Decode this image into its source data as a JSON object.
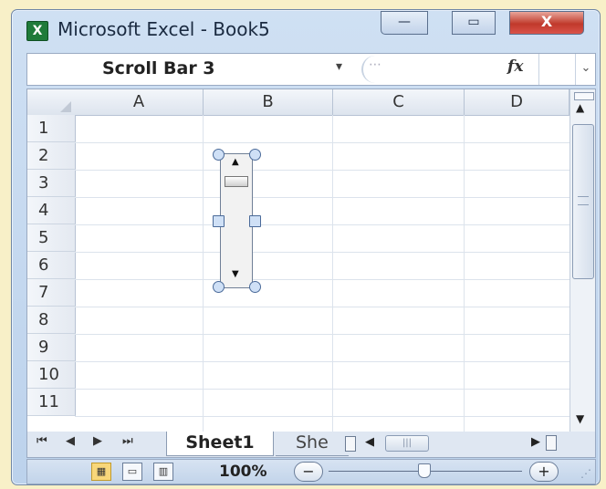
{
  "window": {
    "title": "Microsoft Excel - Book5",
    "app_icon_letter": "X",
    "minimize_glyph": "—",
    "maximize_glyph": "▭",
    "close_glyph": "X"
  },
  "formula_bar": {
    "name_box_value": "Scroll Bar 3",
    "name_box_dropdown": "▾",
    "fx_label": "fx",
    "formula_value": "",
    "expand_glyph": "⌄"
  },
  "columns": [
    "A",
    "B",
    "C",
    "D"
  ],
  "rows": [
    "1",
    "2",
    "3",
    "4",
    "5",
    "6",
    "7",
    "8",
    "9",
    "10",
    "11"
  ],
  "scroll_bar_control": {
    "up_glyph": "▲",
    "down_glyph": "▼"
  },
  "vertical_scrollbar": {
    "up_glyph": "▲",
    "down_glyph": "▼"
  },
  "sheet_tabs": {
    "nav_first": "⏮",
    "nav_prev": "◀",
    "nav_next": "▶",
    "nav_last": "⏭",
    "active": "Sheet1",
    "next_partial": "She"
  },
  "horizontal_scrollbar": {
    "left_glyph": "◀",
    "thumb_grip": "|||",
    "right_glyph": "▶"
  },
  "status_bar": {
    "zoom_level": "100%",
    "zoom_out_glyph": "−",
    "zoom_in_glyph": "+",
    "zoom_fraction": 0.5,
    "active_view": "normal"
  },
  "colors": {
    "accent": "#c0392b",
    "frame": "#bcd2ec",
    "page_bg": "#f8f0c8"
  }
}
